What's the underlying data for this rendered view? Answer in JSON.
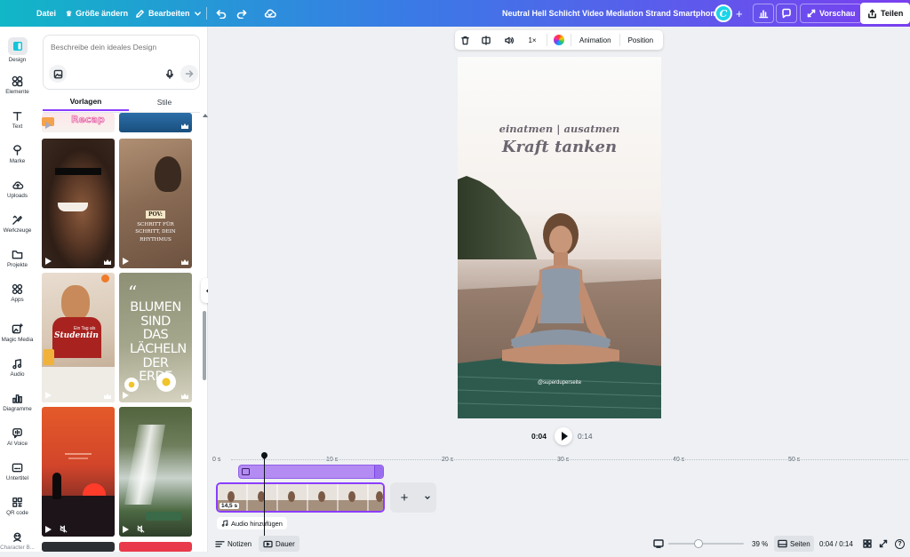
{
  "topbar": {
    "file": "Datei",
    "resize": "Größe ändern",
    "edit": "Bearbeiten",
    "doc_title": "Neutral Hell Schlicht Video Mediation Strand Smartphone-...",
    "avatar_letter": "C",
    "preview": "Vorschau",
    "share": "Teilen"
  },
  "rail": [
    {
      "label": "Design",
      "icon": "design-icon"
    },
    {
      "label": "Elemente",
      "icon": "elements-icon"
    },
    {
      "label": "Text",
      "icon": "text-icon"
    },
    {
      "label": "Marke",
      "icon": "brand-icon"
    },
    {
      "label": "Uploads",
      "icon": "upload-icon"
    },
    {
      "label": "Werkzeuge",
      "icon": "tools-icon"
    },
    {
      "label": "Projekte",
      "icon": "folder-icon"
    },
    {
      "label": "Apps",
      "icon": "apps-icon"
    },
    {
      "label": "Magic Media",
      "icon": "magic-media-icon"
    },
    {
      "label": "Audio",
      "icon": "music-icon"
    },
    {
      "label": "Diagramme",
      "icon": "chart-icon"
    },
    {
      "label": "AI Voice",
      "icon": "voice-icon"
    },
    {
      "label": "Untertitel",
      "icon": "captions-icon"
    },
    {
      "label": "QR code",
      "icon": "qr-icon"
    },
    {
      "label": "Character B...",
      "icon": "character-icon"
    }
  ],
  "panel": {
    "prompt_placeholder": "Beschreibe dein ideales Design",
    "tab_templates": "Vorlagen",
    "tab_styles": "Stile",
    "thumb_recap": "Recap",
    "thumb_pov_badge": "POV:",
    "thumb_pov_text": "SCHRITT FÜR SCHRITT, DEIN RHYTHMUS",
    "thumb_student_small": "Ein Tag als",
    "thumb_student": "Studentin",
    "thumb_quote": "BLUMEN SIND DAS LÄCHELN DER ERDE",
    "thumb_quote_mark": "“"
  },
  "contextbar": {
    "speed": "1×",
    "animation": "Animation",
    "position": "Position"
  },
  "canvas": {
    "line1": "einatmen | ausatmen",
    "line2": "Kraft tanken",
    "handle": "@superduperseite"
  },
  "playback": {
    "current": "0:04",
    "total": "0:14"
  },
  "timeline": {
    "ticks": [
      "0 s",
      "10 s",
      "20 s",
      "30 s",
      "40 s",
      "50 s"
    ],
    "clip_duration": "14,5 s",
    "audio_hint": "Audio hinzufügen"
  },
  "bottombar": {
    "notes": "Notizen",
    "duration": "Dauer",
    "zoom_percent": "39 %",
    "zoom_value": 39,
    "pages": "Seiten",
    "time": "0:04 / 0:14",
    "help": "?"
  },
  "colors": {
    "accent": "#8b3dff",
    "topbar_start": "#11b6c7",
    "topbar_end": "#7a3ff0"
  }
}
